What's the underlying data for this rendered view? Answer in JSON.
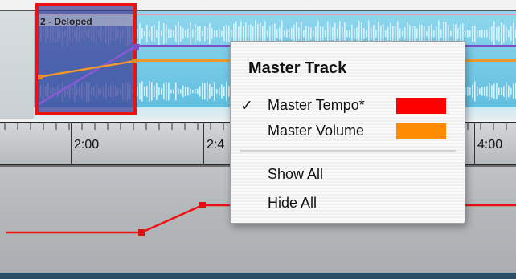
{
  "loop": {
    "title": "2 - Deloped"
  },
  "ruler": {
    "labels": [
      "2:00",
      "2:4",
      "4:00"
    ]
  },
  "menu": {
    "title": "Master Track",
    "items": [
      {
        "label": "Master Tempo*",
        "checked": true,
        "check_glyph": "✓",
        "swatch_color": "#ff0000"
      },
      {
        "label": "Master Volume",
        "checked": false,
        "check_glyph": "",
        "swatch_color": "#ff8c00"
      },
      {
        "label": "Show All"
      },
      {
        "label": "Hide All"
      }
    ]
  },
  "colors": {
    "tempo": "#ff0000",
    "volume": "#ff8c00",
    "waveform": "#62bfe0",
    "loop_border": "#ee1111",
    "purple_curve": "#7c4fc9"
  }
}
